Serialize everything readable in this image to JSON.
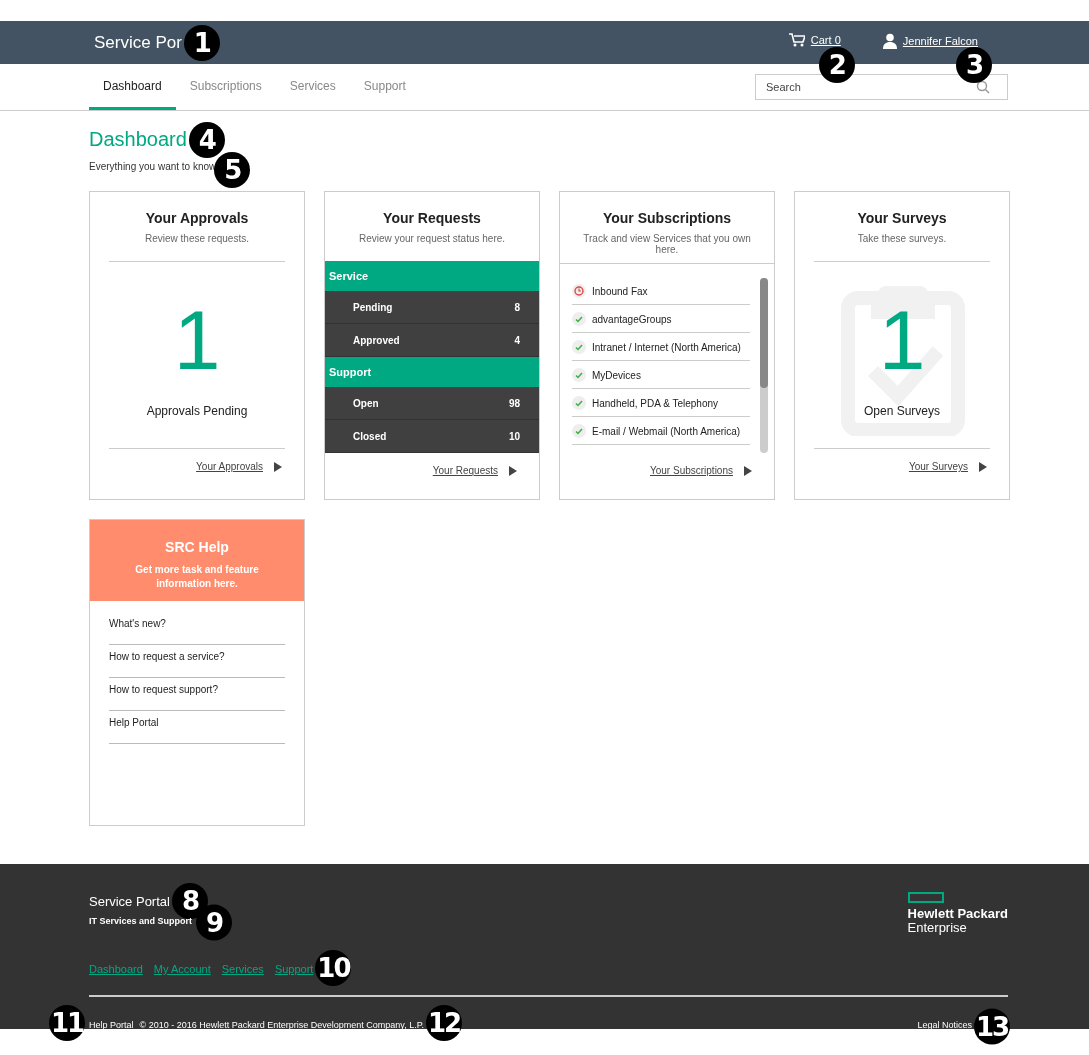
{
  "header": {
    "brand": "Service Por",
    "brand_callout": "1",
    "cart": {
      "label": "Cart 0",
      "callout": "2"
    },
    "user": {
      "name": "Jennifer Falcon",
      "callout": "3"
    }
  },
  "tabs": [
    {
      "label": "Dashboard",
      "selected": true
    },
    {
      "label": "Subscriptions",
      "selected": false
    },
    {
      "label": "Services",
      "selected": false
    },
    {
      "label": "Support",
      "selected": false
    }
  ],
  "search": {
    "placeholder": "Search"
  },
  "page": {
    "title": "Dashboard",
    "title_callout": "4",
    "subtitle": "Everything you want to know",
    "subtitle_callout": "5"
  },
  "approvals": {
    "title": "Your Approvals",
    "subtitle": "Review these requests.",
    "count": "1",
    "count_label": "Approvals Pending",
    "link": "Your Approvals"
  },
  "requests": {
    "title": "Your Requests",
    "subtitle": "Review your request status here.",
    "groups": [
      {
        "name": "Service",
        "rows": [
          {
            "label": "Pending",
            "value": "8"
          },
          {
            "label": "Approved",
            "value": "4"
          }
        ]
      },
      {
        "name": "Support",
        "rows": [
          {
            "label": "Open",
            "value": "98"
          },
          {
            "label": "Closed",
            "value": "10"
          }
        ]
      }
    ],
    "link": "Your Requests"
  },
  "subscriptions": {
    "title": "Your Subscriptions",
    "subtitle": "Track and view Services that you own here.",
    "items": [
      {
        "name": "Inbound Fax",
        "warning": true
      },
      {
        "name": "advantageGroups",
        "warning": false
      },
      {
        "name": "Intranet / Internet (North America)",
        "warning": false
      },
      {
        "name": "MyDevices",
        "warning": false
      },
      {
        "name": "Handheld, PDA & Telephony",
        "warning": false
      },
      {
        "name": "E-mail / Webmail (North America)",
        "warning": false
      }
    ],
    "link": "Your Subscriptions"
  },
  "surveys": {
    "title": "Your Surveys",
    "subtitle": "Take these surveys.",
    "count": "1",
    "count_label": "Open Surveys",
    "link": "Your Surveys"
  },
  "help": {
    "title": "SRC Help",
    "subtitle": "Get more task and feature information here.",
    "links": [
      "What's new?",
      "How to request a service?",
      "How to request support?",
      "Help Portal"
    ]
  },
  "footer": {
    "brand": "Service Portal",
    "brand_callout": "8",
    "tagline": "IT Services and Support",
    "tagline_callout": "9",
    "links": [
      "Dashboard",
      "My Account",
      "Services",
      "Support"
    ],
    "links_callout": "10",
    "help_link": "Help Portal",
    "help_callout": "11",
    "copyright": "© 2010 - 2016 Hewlett Packard Enterprise Development Company, L.P.",
    "copyright_callout": "12",
    "legal": "Legal Notices",
    "legal_callout": "13",
    "logo": {
      "line1": "Hewlett Packard",
      "line2": "Enterprise"
    }
  }
}
